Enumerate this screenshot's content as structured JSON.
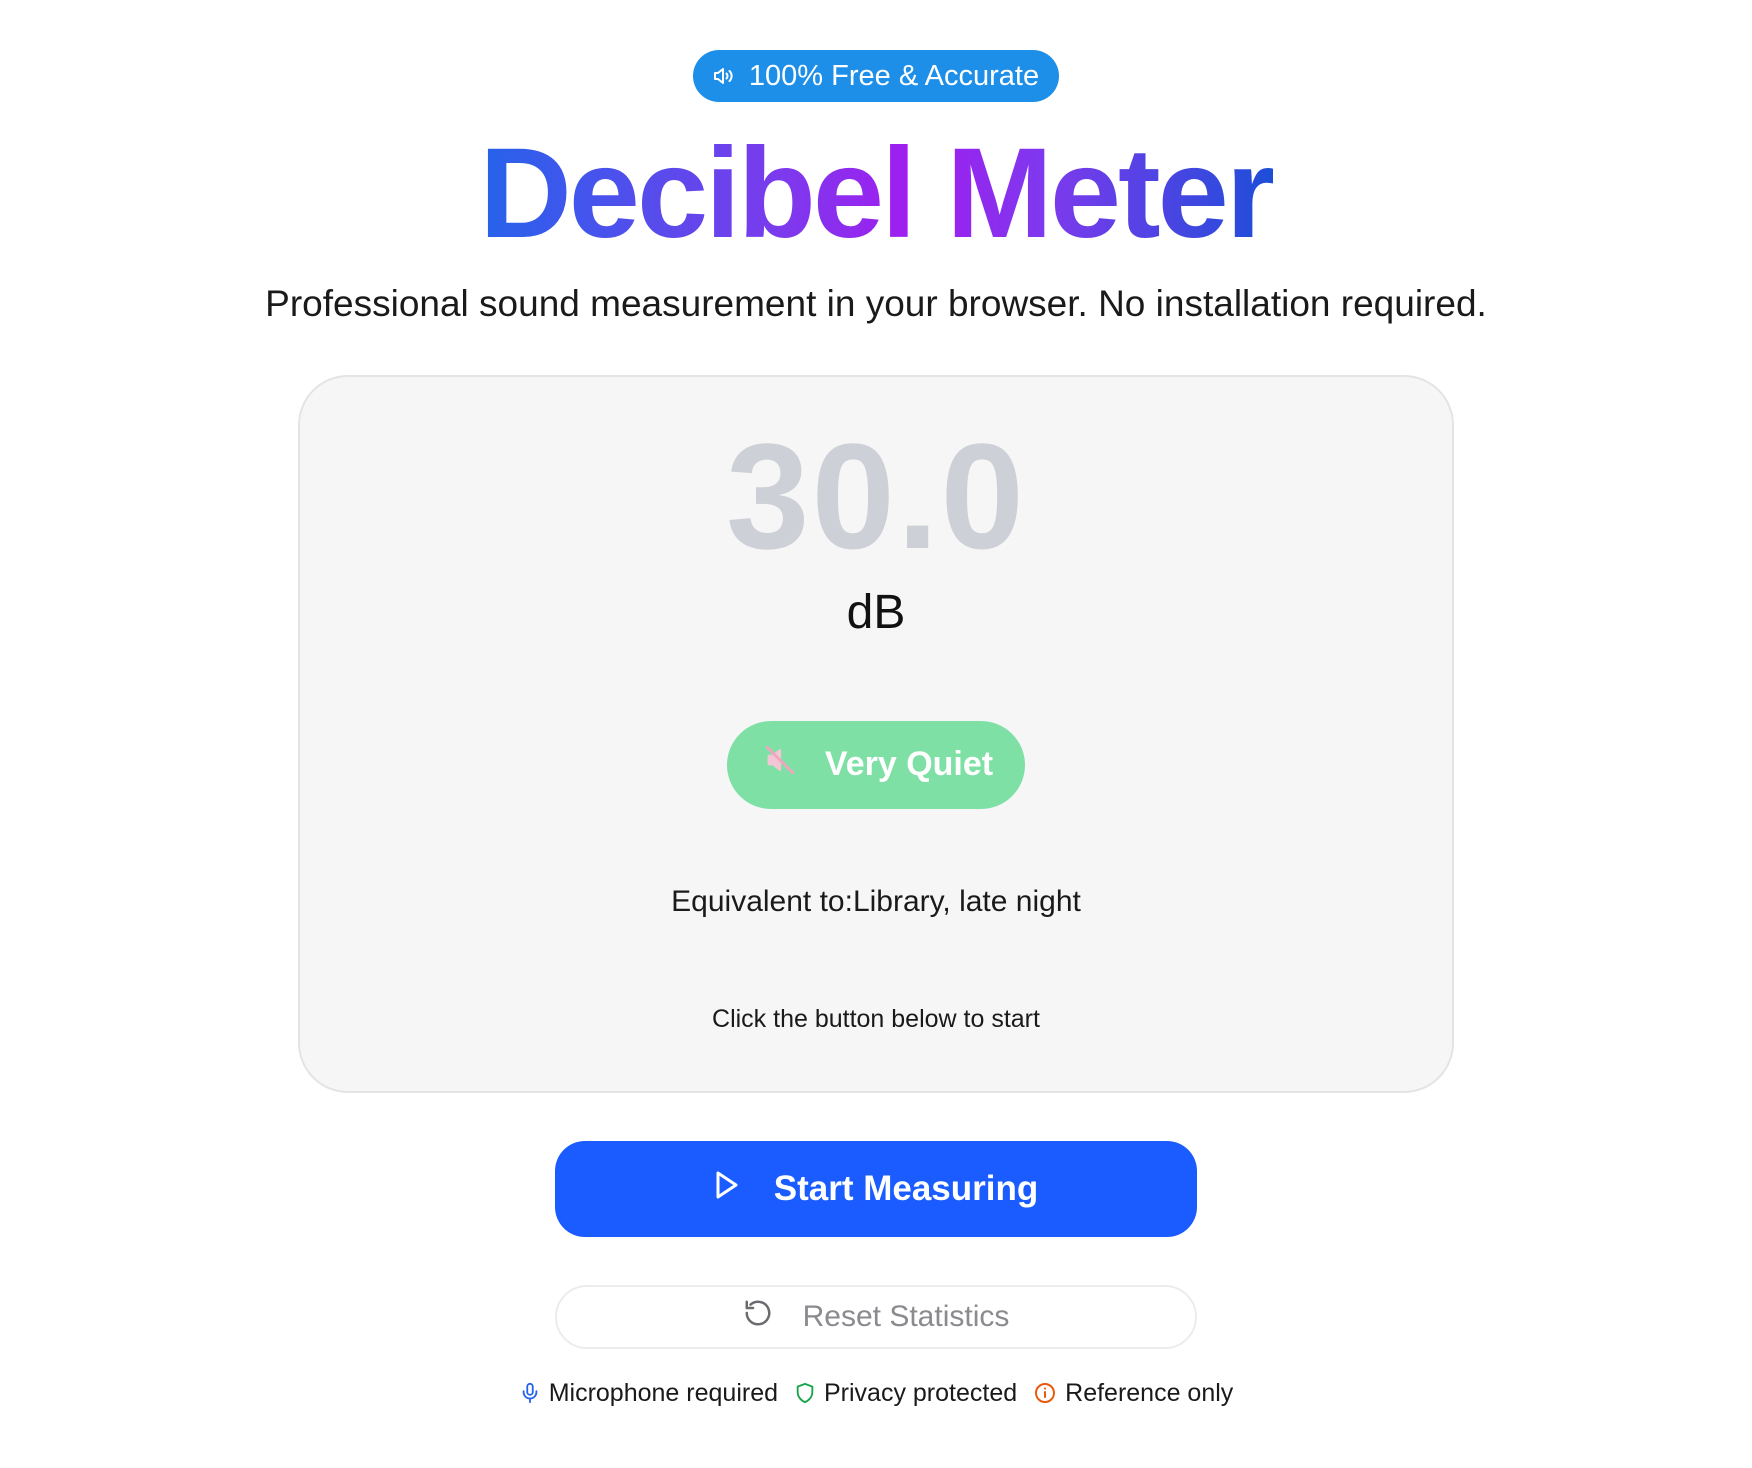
{
  "badge": {
    "icon": "speaker-icon",
    "text": "100% Free & Accurate",
    "color": "#1d8fe8"
  },
  "header": {
    "title": "Decibel Meter",
    "subtitle": "Professional sound measurement in your browser. No installation required."
  },
  "meter": {
    "value": "30.0",
    "unit": "dB",
    "level": {
      "label": "Very Quiet",
      "icon": "muted-speaker-icon",
      "color": "#7fe0a6"
    },
    "equivalent": "Equivalent to:Library, late night",
    "hint": "Click the button below to start"
  },
  "actions": {
    "start_label": "Start Measuring",
    "start_icon": "play-icon",
    "start_color": "#1a5cff",
    "reset_label": "Reset Statistics",
    "reset_icon": "reset-icon"
  },
  "footer": {
    "items": [
      {
        "icon": "microphone-icon",
        "label": "Microphone required",
        "color": "#2563eb"
      },
      {
        "icon": "shield-icon",
        "label": "Privacy protected",
        "color": "#16a34a"
      },
      {
        "icon": "info-icon",
        "label": "Reference only",
        "color": "#ea580c"
      }
    ]
  }
}
